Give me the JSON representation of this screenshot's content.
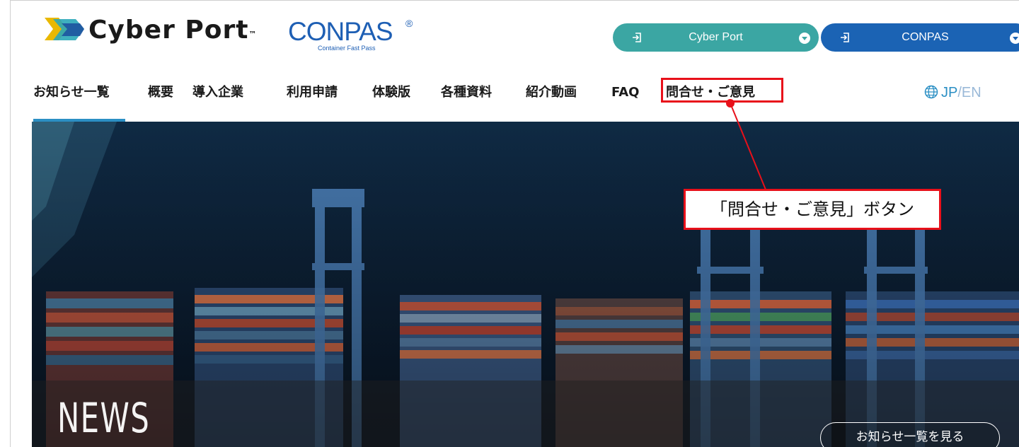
{
  "header": {
    "cyberport_logo_text": "Cyber Port",
    "cyberport_tm": "™",
    "conpas_logo_text": "CONPAS",
    "conpas_reg": "®",
    "conpas_subtitle": "Container Fast Pass",
    "login_buttons": [
      {
        "label": "Cyber Port",
        "color": "#3ba6a3",
        "icon": "login-icon"
      },
      {
        "label": "CONPAS",
        "color": "#1b63b4",
        "icon": "login-icon"
      }
    ]
  },
  "nav": {
    "items": [
      {
        "label": "お知らせ一覧",
        "active": true
      },
      {
        "label": "概要"
      },
      {
        "label": "導入企業"
      },
      {
        "label": "利用申請"
      },
      {
        "label": "体験版"
      },
      {
        "label": "各種資料"
      },
      {
        "label": "紹介動画"
      },
      {
        "label": "FAQ"
      },
      {
        "label": "問合せ・ご意見"
      }
    ],
    "lang": {
      "jp": "JP",
      "sep": "/",
      "en": "EN",
      "icon": "globe-icon"
    },
    "accent_color": "#2b8fc4"
  },
  "hero": {
    "title": "NEWS",
    "button_label": "お知らせ一覧を見る"
  },
  "annotation": {
    "callout_text": "「問合せ・ご意見」ボタン",
    "color": "#e8101a"
  }
}
